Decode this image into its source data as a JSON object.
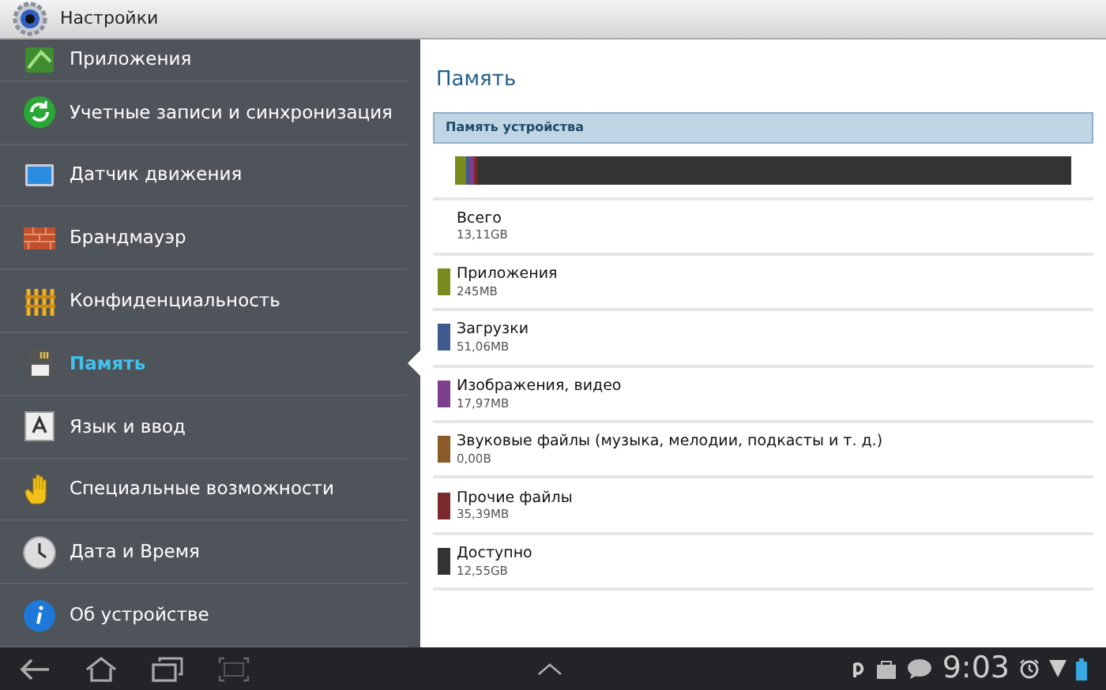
{
  "title_bar": {
    "title": "Настройки"
  },
  "sidebar": {
    "items": [
      {
        "label": "Приложения",
        "selected": false
      },
      {
        "label": "Учетные записи и синхронизация",
        "selected": false
      },
      {
        "label": "Датчик движения",
        "selected": false
      },
      {
        "label": "Брандмауэр",
        "selected": false
      },
      {
        "label": "Конфиденциальность",
        "selected": false
      },
      {
        "label": "Память",
        "selected": true
      },
      {
        "label": "Язык и ввод",
        "selected": false
      },
      {
        "label": "Специальные возможности",
        "selected": false
      },
      {
        "label": "Дата и Время",
        "selected": false
      },
      {
        "label": "Об устройстве",
        "selected": false
      }
    ]
  },
  "panel": {
    "title": "Память",
    "section": "Память устройства",
    "storage_bar": {
      "segments": [
        {
          "color": "#7a8a1c",
          "level": 0.018
        },
        {
          "color": "#3f5a8f",
          "level": 0.006
        },
        {
          "color": "#7d3f8c",
          "level": 0.006
        },
        {
          "color": "#7a2a2a",
          "level": 0.006
        }
      ]
    },
    "rows": [
      {
        "label": "Всего",
        "value": "13,11GB"
      },
      {
        "label": "Приложения",
        "value": "245MB",
        "color": "#7a8a1c"
      },
      {
        "label": "Загрузки",
        "value": "51,06MB",
        "color": "#3f5a8f"
      },
      {
        "label": "Изображения, видео",
        "value": "17,97MB",
        "color": "#7d3f8c"
      },
      {
        "label": "Звуковые файлы (музыка, мелодии, подкасты и т. д.)",
        "value": "0,00B",
        "color": "#8a5a28"
      },
      {
        "label": "Прочие файлы",
        "value": "35,39MB",
        "color": "#7a2a2a"
      },
      {
        "label": "Доступно",
        "value": "12,55GB",
        "color": "#333333"
      }
    ]
  },
  "nav_bar": {
    "time": "9:03"
  }
}
